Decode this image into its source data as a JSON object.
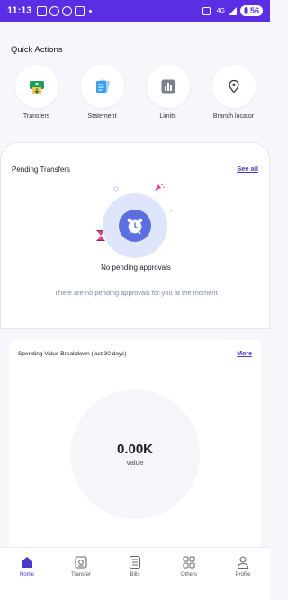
{
  "status_bar": {
    "time": "11:13",
    "network": "4G",
    "battery": "56"
  },
  "quick_actions": {
    "title": "Quick Actions",
    "items": [
      {
        "label": "Transfers",
        "icon": "transfer-icon"
      },
      {
        "label": "Statement",
        "icon": "statement-icon"
      },
      {
        "label": "Limits",
        "icon": "limits-icon"
      },
      {
        "label": "Branch locator",
        "icon": "location-pin-icon"
      }
    ]
  },
  "pending_transfers": {
    "title": "Pending Transfers",
    "see_all": "See all",
    "empty_title": "No pending approvals",
    "empty_subtitle": "There are no pending approvals for you at the moment"
  },
  "spending": {
    "title": "Spending Value Breakdown (last 30 days)",
    "more": "More",
    "total": "0.00K",
    "caption": "value"
  },
  "bottom_nav": {
    "items": [
      {
        "label": "Home",
        "icon": "home-icon",
        "active": true
      },
      {
        "label": "Transfer",
        "icon": "transfer-icon"
      },
      {
        "label": "Bills",
        "icon": "bills-icon"
      },
      {
        "label": "Others",
        "icon": "grid-icon"
      },
      {
        "label": "Profile",
        "icon": "profile-icon"
      }
    ]
  },
  "colors": {
    "accent": "#5b2ee6",
    "link": "#4b39c9",
    "illustration": "#5b6fe0"
  }
}
